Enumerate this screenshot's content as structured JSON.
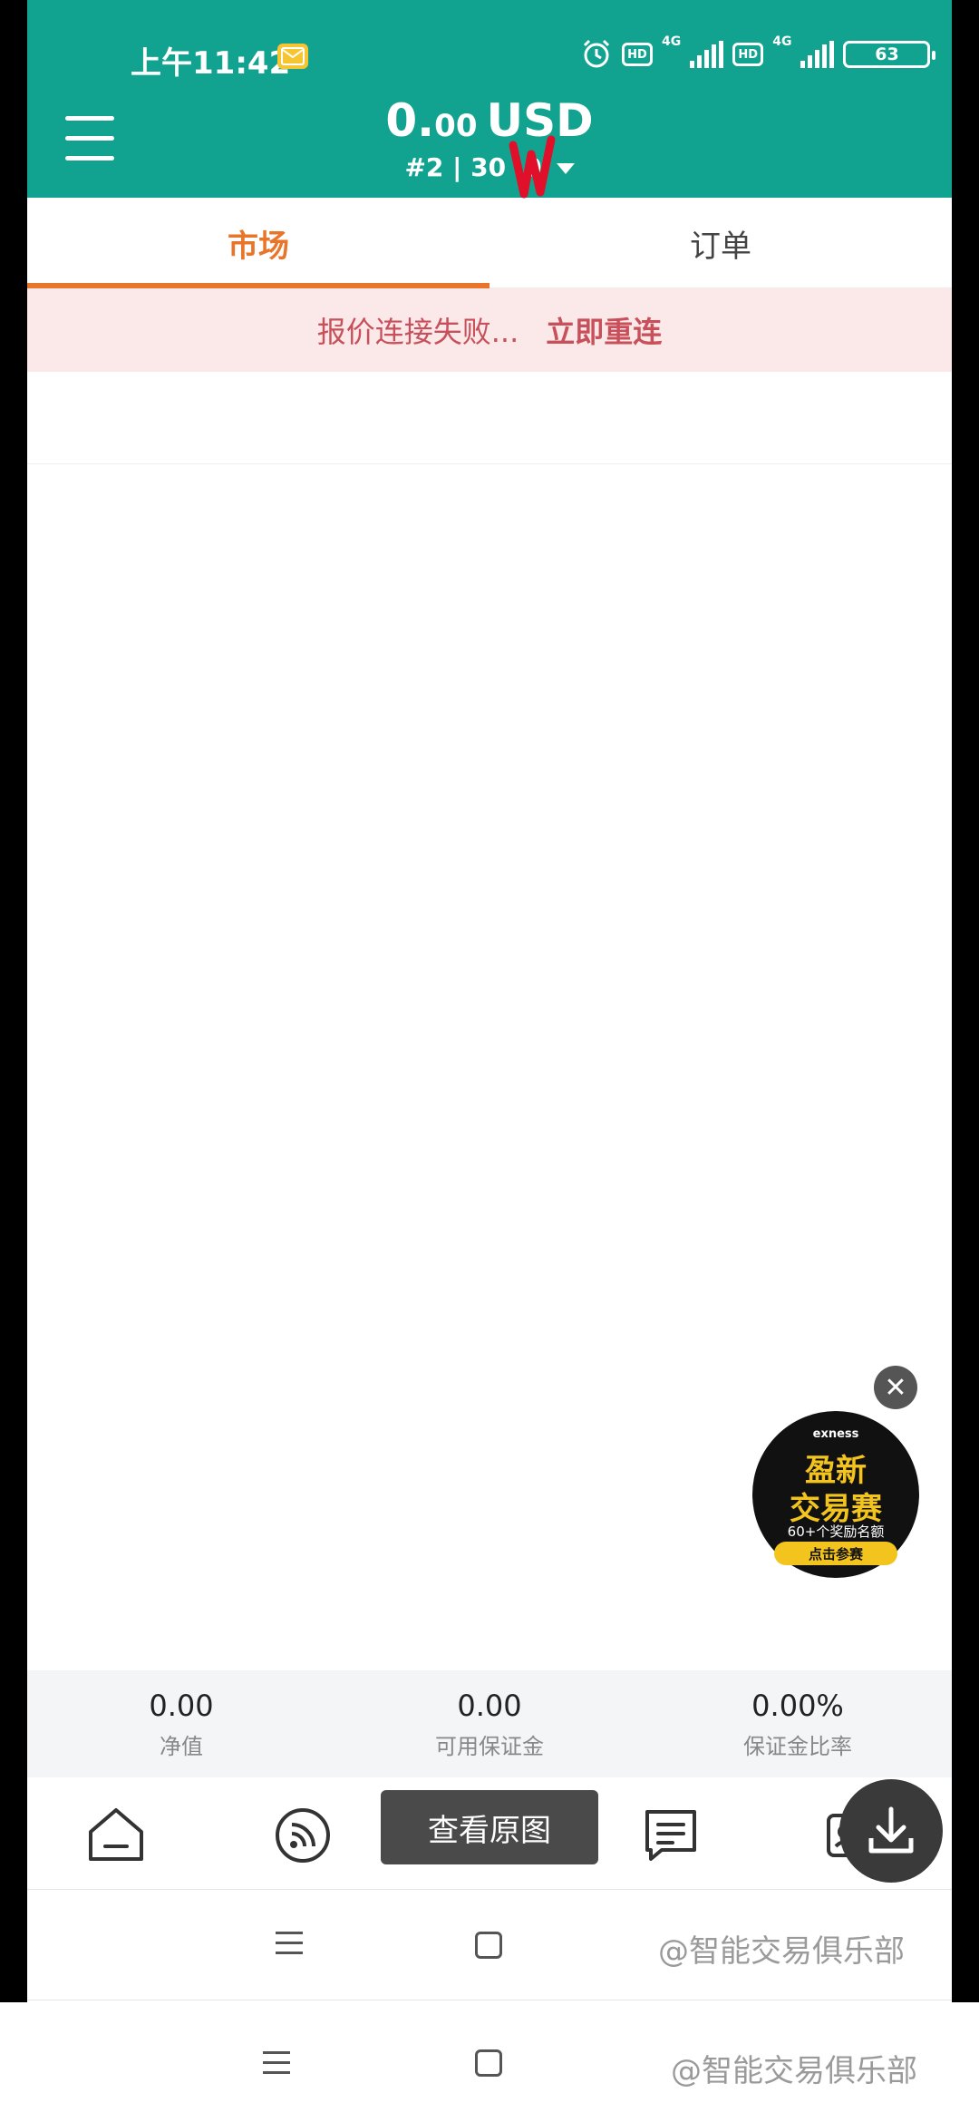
{
  "status_bar": {
    "time": "上午11:42",
    "hd1": "HD",
    "net1": "4G",
    "hd2": "HD",
    "net2": "4G",
    "battery": "63"
  },
  "header": {
    "balance_int": "0.",
    "balance_dec": "00",
    "currency": "USD",
    "account": "#2 | 30",
    "account_tail": "0"
  },
  "tabs": {
    "market": "市场",
    "orders": "订单"
  },
  "alert": {
    "message": "报价连接失败...",
    "action": "立即重连"
  },
  "promo": {
    "brand": "exness",
    "title_line1": "盈新",
    "title_line2": "交易赛",
    "subtitle": "60+个奖励名额",
    "button": "点击参赛",
    "close": "✕"
  },
  "stats": [
    {
      "value": "0.00",
      "label": "净值"
    },
    {
      "value": "0.00",
      "label": "可用保证金"
    },
    {
      "value": "0.00%",
      "label": "保证金比率"
    }
  ],
  "overlay": {
    "view_original": "查看原图"
  },
  "watermark": "@智能交易俱乐部",
  "colors": {
    "header_bg": "#11a38f",
    "accent_orange": "#e8752a",
    "alert_bg": "#fbe9e9",
    "alert_text": "#c7505a"
  },
  "icons": {
    "menu": "menu-icon",
    "home": "home-icon",
    "feed": "rss-icon",
    "news": "message-icon",
    "profile": "id-card-icon",
    "download": "download-icon"
  }
}
